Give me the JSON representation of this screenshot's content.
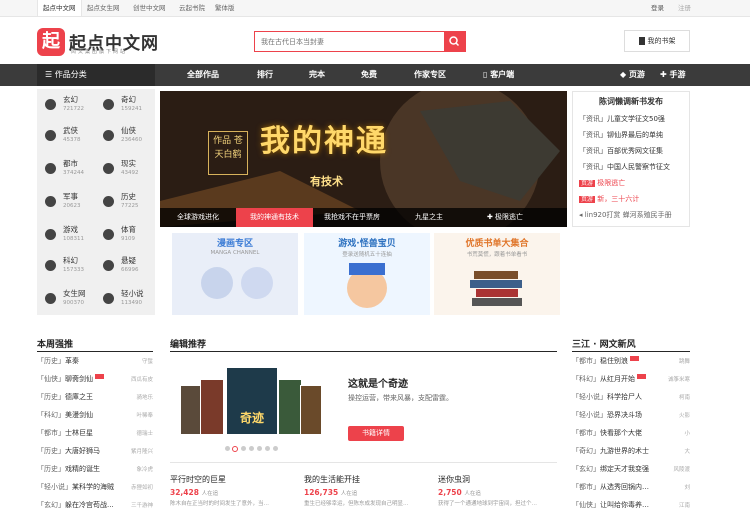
{
  "topbar": {
    "sites": [
      "起点中文网",
      "起点女生网",
      "创世中文网",
      "云起书院",
      "繁体版"
    ],
    "login": "登录",
    "register": "注册"
  },
  "logo": {
    "mark": "起",
    "name": "起点中文网",
    "sub": "阅文集团旗下网站"
  },
  "search": {
    "placeholder": "我在古代日本当封妻"
  },
  "bookshelf": "我的书架",
  "nav": {
    "category": "作品分类",
    "items": [
      "全部作品",
      "排行",
      "完本",
      "免费",
      "作家专区",
      "客户端",
      "页游",
      "手游"
    ]
  },
  "genres": [
    {
      "name": "玄幻",
      "count": "721722"
    },
    {
      "name": "奇幻",
      "count": "159241"
    },
    {
      "name": "武侠",
      "count": "45378"
    },
    {
      "name": "仙侠",
      "count": "236460"
    },
    {
      "name": "都市",
      "count": "374244"
    },
    {
      "name": "现实",
      "count": "43492"
    },
    {
      "name": "军事",
      "count": "20623"
    },
    {
      "name": "历史",
      "count": "77225"
    },
    {
      "name": "游戏",
      "count": "108311"
    },
    {
      "name": "体育",
      "count": "9109"
    },
    {
      "name": "科幻",
      "count": "157333"
    },
    {
      "name": "悬疑",
      "count": "66996"
    },
    {
      "name": "女生网",
      "count": "900370"
    },
    {
      "name": "轻小说",
      "count": "113490"
    }
  ],
  "banner": {
    "title": "我的神通",
    "subtitle": "有技术",
    "tag": "作品 苍天白鹤",
    "tabs": [
      "全球游戏进化",
      "我的神通有技术",
      "我抢戏不在乎票房",
      "九星之主",
      "极限逃亡"
    ]
  },
  "news": {
    "heading": "陈词懒调新书发布",
    "rows": [
      {
        "label": "「资讯」",
        "text": "儿童文学征文50强"
      },
      {
        "label": "「资讯」",
        "text": "铆仙界最后的单纯"
      },
      {
        "label": "「资讯」",
        "text": "百部优秀网文征集"
      },
      {
        "label": "「资讯」",
        "text": "中国人民警察节征文"
      },
      {
        "label": "页游",
        "text": "极限逃亡"
      },
      {
        "label": "页游",
        "text": "新，三十六计"
      },
      {
        "label": "",
        "text": "lin920打赏 蝉河系殖民手册"
      }
    ]
  },
  "promos": [
    {
      "title": "漫画专区",
      "sub": "MANGA CHANNEL"
    },
    {
      "title": "游戏·怪兽宝贝",
      "sub": "登录送随机五十连抽"
    },
    {
      "title": "优质书单大集合",
      "sub": "书荒莫慌，跟着书单看书"
    }
  ],
  "weekly": {
    "heading": "本周强推",
    "rows": [
      {
        "tag": "「历史」",
        "title": "革秦",
        "meta": "守蜇"
      },
      {
        "tag": "「仙侠」",
        "title": "聊斋剑仙",
        "meta": "西瓜有皮"
      },
      {
        "tag": "「历史」",
        "title": "德庫之王",
        "meta": "骑地乐"
      },
      {
        "tag": "「科幻」",
        "title": "美漫剑仙",
        "meta": "叶稀奉"
      },
      {
        "tag": "「都市」",
        "title": "士林巨星",
        "meta": "德瑞士"
      },
      {
        "tag": "「历史」",
        "title": "大唐好狮马",
        "meta": "紫月隆兴"
      },
      {
        "tag": "「历史」",
        "title": "戏精的诞生",
        "meta": "象冷虎"
      },
      {
        "tag": "「轻小说」",
        "title": "某科学的海贼",
        "meta": "赤狸如初"
      },
      {
        "tag": "「玄幻」",
        "title": "躲在冷宫苟战...",
        "meta": "三千游神"
      }
    ]
  },
  "editor": {
    "heading": "编辑推荐",
    "feature_title": "这就是个奇迹",
    "feature_desc": "操控运营，带来风暴，支配雷霆。",
    "feature_button": "书籍详情",
    "cover_text": "奇迹",
    "books": [
      {
        "title": "平行时空的巨星",
        "count": "32,428",
        "unit": "人在追",
        "desc": "陈木自在正当时的时间发生了意外，当…"
      },
      {
        "title": "我的生活能开挂",
        "count": "126,735",
        "unit": "人在追",
        "desc": "重生已经够幸运，但陈东成发现自己明显…"
      },
      {
        "title": "迷你虫洞",
        "count": "2,750",
        "unit": "人在追",
        "desc": "获得了一个通通地球到宇宙间，担过个…"
      }
    ]
  },
  "sanjiang": {
    "heading": "三江 · 网文新风",
    "rows": [
      {
        "tag": "「都市」",
        "title": "稳住别浪",
        "meta": "跳舞"
      },
      {
        "tag": "「科幻」",
        "title": "从红月开始",
        "meta": "诚筝米寒"
      },
      {
        "tag": "「轻小说」",
        "title": "科学拾尸人",
        "meta": "柯南"
      },
      {
        "tag": "「轻小说」",
        "title": "恐界决斗场",
        "meta": "火影"
      },
      {
        "tag": "「都市」",
        "title": "快看那个大佬",
        "meta": "小"
      },
      {
        "tag": "「奇幻」",
        "title": "九游世界的术士",
        "meta": "大"
      },
      {
        "tag": "「玄幻」",
        "title": "绑定天才我变强",
        "meta": "风陵渡"
      },
      {
        "tag": "「都市」",
        "title": "从选秀回锅内…",
        "meta": "刘"
      },
      {
        "tag": "「仙侠」",
        "title": "让叫给你毒养…",
        "meta": "江南"
      }
    ]
  }
}
